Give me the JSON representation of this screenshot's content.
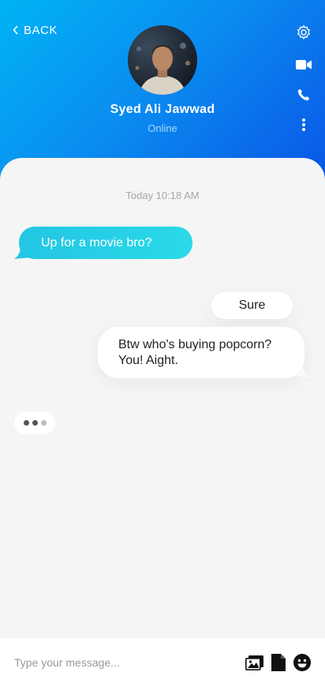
{
  "header": {
    "back_label": "BACK",
    "contact_name": "Syed Ali Jawwad",
    "contact_status": "Online",
    "icons": [
      "gear-icon",
      "video-camera-icon",
      "phone-icon",
      "more-vertical-icon"
    ]
  },
  "chat": {
    "timestamp": "Today 10:18 AM",
    "messages": [
      {
        "side": "in",
        "text": "Up for a movie bro?"
      },
      {
        "side": "out",
        "text": "Sure"
      },
      {
        "side": "out",
        "text": "Btw who's buying popcorn? You! Aight."
      }
    ],
    "typing_indicator": true
  },
  "composer": {
    "placeholder": "Type your message...",
    "icons": [
      "image-icon",
      "file-icon",
      "emoji-icon"
    ]
  },
  "colors": {
    "header_start": "#00b4f5",
    "header_end": "#0a55e6",
    "incoming_bubble": "#23c6e3",
    "outgoing_bubble": "#ffffff"
  }
}
